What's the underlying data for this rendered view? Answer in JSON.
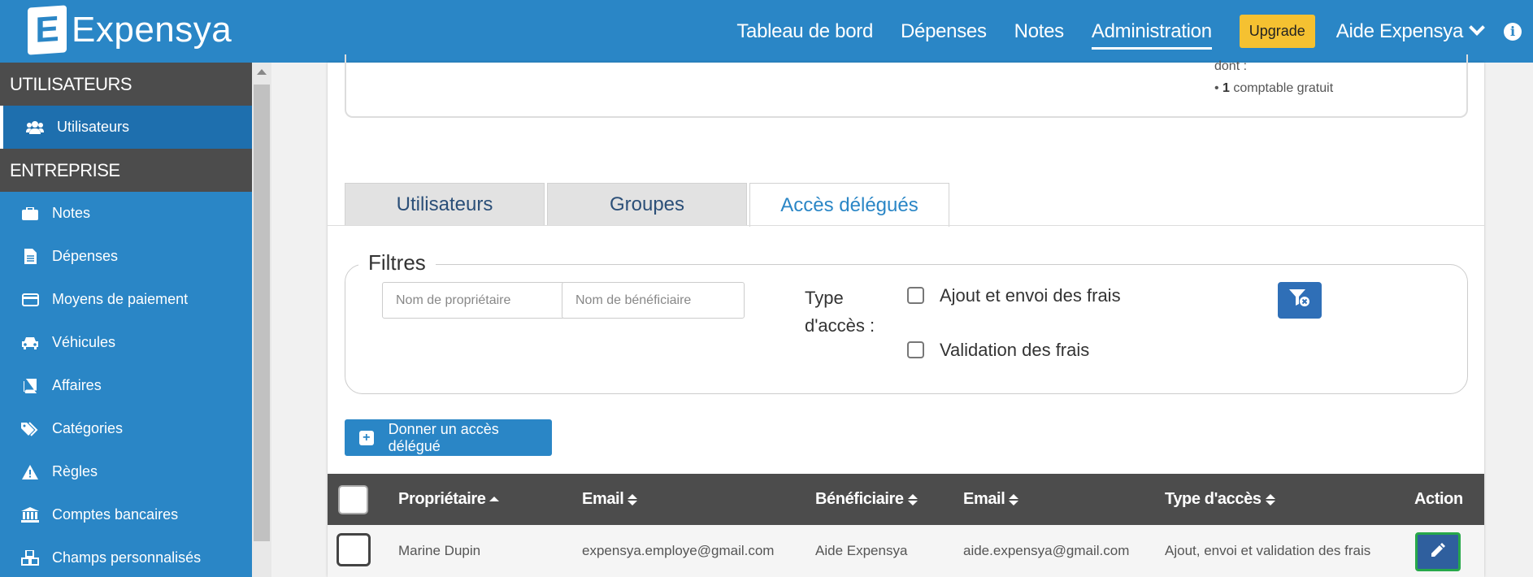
{
  "app": {
    "logo_letter": "E",
    "name": "Expensya"
  },
  "nav": {
    "items": [
      "Tableau de bord",
      "Dépenses",
      "Notes",
      "Administration"
    ],
    "active": "Administration",
    "upgrade": "Upgrade",
    "user": "Aide Expensya"
  },
  "sidebar": {
    "section_users": "UTILISATEURS",
    "users_item": "Utilisateurs",
    "section_company": "ENTREPRISE",
    "items": [
      "Notes",
      "Dépenses",
      "Moyens de paiement",
      "Véhicules",
      "Affaires",
      "Catégories",
      "Règles",
      "Comptes bancaires",
      "Champs personnalisés"
    ]
  },
  "summary": {
    "dont": "dont :",
    "bullet": "• ",
    "count": "1",
    "rest": " comptable gratuit"
  },
  "tabs": [
    "Utilisateurs",
    "Groupes",
    "Accès délégués"
  ],
  "active_tab": "Accès délégués",
  "filters": {
    "legend": "Filtres",
    "owner_placeholder": "Nom de propriétaire",
    "beneficiary_placeholder": "Nom de bénéficiaire",
    "type_label": "Type d'accès :",
    "option1": "Ajout et envoi des frais",
    "option2": "Validation des frais"
  },
  "add_button": "Donner un accès délégué",
  "table": {
    "headers": [
      "Propriétaire",
      "Email",
      "Bénéficiaire",
      "Email",
      "Type d'accès",
      "Action"
    ],
    "rows": [
      {
        "owner": "Marine Dupin",
        "owner_email": "expensya.employe@gmail.com",
        "beneficiary": "Aide Expensya",
        "beneficiary_email": "aide.expensya@gmail.com",
        "type": "Ajout, envoi et validation des frais"
      }
    ]
  },
  "colors": {
    "primary": "#2a86c6",
    "dark": "#4c4c4c",
    "upgrade": "#f5c131"
  }
}
